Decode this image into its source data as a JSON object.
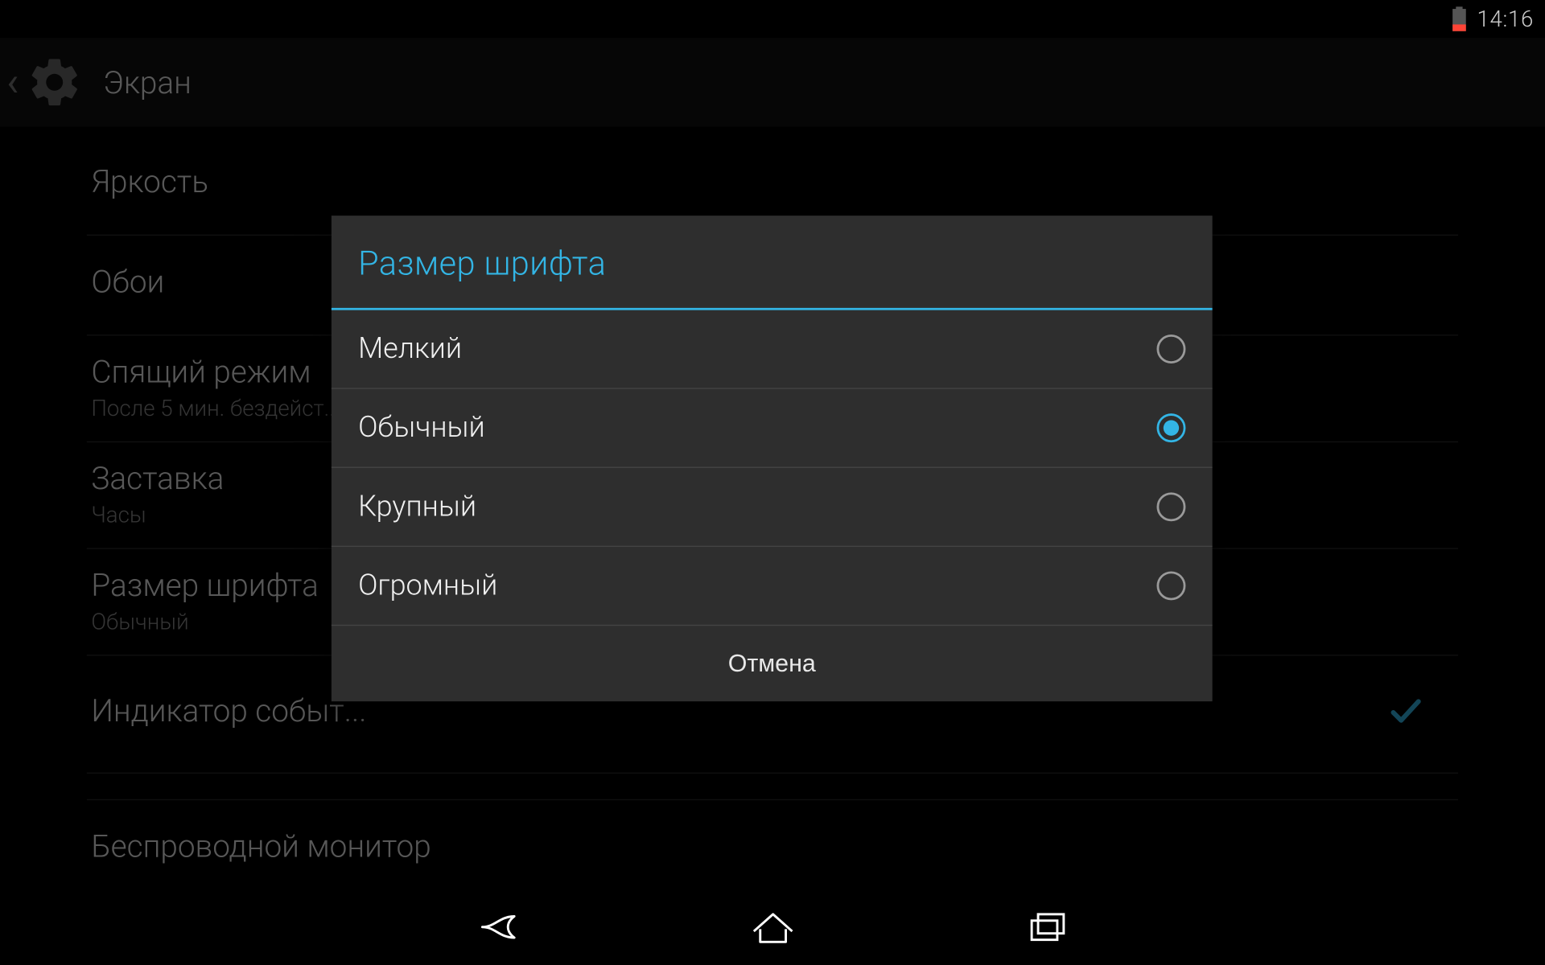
{
  "status": {
    "time": "14:16"
  },
  "action_bar": {
    "title": "Экран"
  },
  "settings": [
    {
      "title": "Яркость",
      "sub": ""
    },
    {
      "title": "Обои",
      "sub": ""
    },
    {
      "title": "Спящий режим",
      "sub": "После 5 мин. бездейст..."
    },
    {
      "title": "Заставка",
      "sub": "Часы"
    },
    {
      "title": "Размер шрифта",
      "sub": "Обычный"
    },
    {
      "title": "Индикатор событ...",
      "sub": "",
      "checkbox": true,
      "checked": true
    },
    {
      "title": "Беспроводной монитор",
      "sub": ""
    }
  ],
  "dialog": {
    "title": "Размер шрифта",
    "options": [
      {
        "label": "Мелкий",
        "selected": false
      },
      {
        "label": "Обычный",
        "selected": true
      },
      {
        "label": "Крупный",
        "selected": false
      },
      {
        "label": "Огромный",
        "selected": false
      }
    ],
    "cancel_label": "Отмена"
  },
  "colors": {
    "accent": "#33b5e5"
  }
}
